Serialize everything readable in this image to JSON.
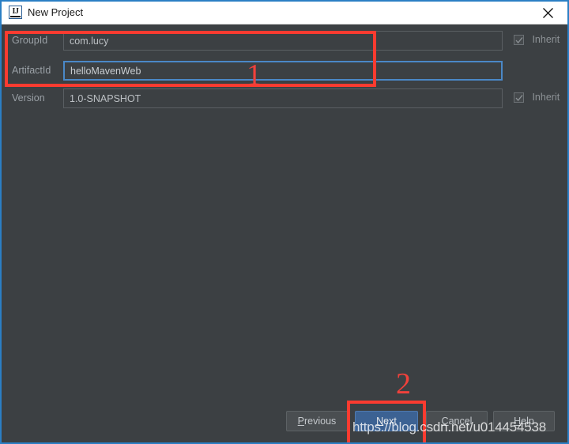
{
  "window": {
    "title": "New Project",
    "app_icon": "intellij-idea-icon",
    "icon_text": "IJ",
    "close_icon": "close-icon",
    "focus_border_color": "#2b7fc4",
    "body_background": "#3c4043"
  },
  "form": {
    "rows": [
      {
        "label": "GroupId",
        "value": "com.lucy",
        "focused": false,
        "inherit": {
          "label": "Inherit",
          "checked": true,
          "enabled": false
        }
      },
      {
        "label": "ArtifactId",
        "value": "helloMavenWeb",
        "focused": true,
        "inherit": null
      },
      {
        "label": "Version",
        "value": "1.0-SNAPSHOT",
        "focused": false,
        "inherit": {
          "label": "Inherit",
          "checked": true,
          "enabled": false
        }
      }
    ]
  },
  "buttons": {
    "previous": {
      "label": "Previous",
      "mnemonic": "P",
      "primary": false
    },
    "next": {
      "label": "Next",
      "mnemonic": "N",
      "primary": true
    },
    "cancel": {
      "label": "Cancel",
      "mnemonic": "C",
      "primary": false
    },
    "help": {
      "label": "Help",
      "mnemonic": "H",
      "primary": false
    }
  },
  "watermark": {
    "text": "https://blog.csdn.net/u014454538"
  },
  "annotations": {
    "color": "#fb3b30",
    "marker_1": "1",
    "marker_2": "2"
  }
}
